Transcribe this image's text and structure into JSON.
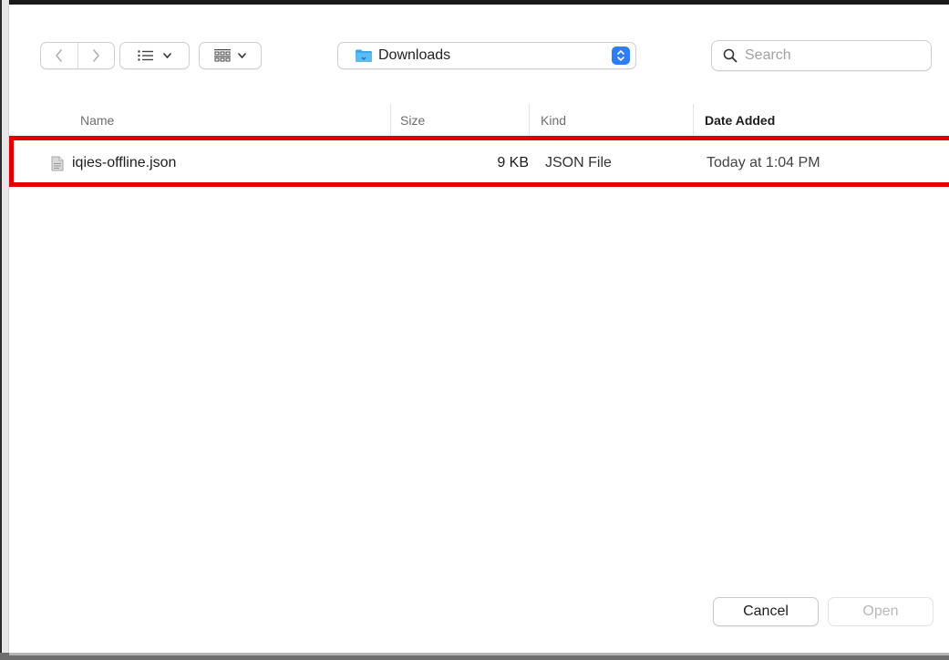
{
  "toolbar": {
    "back_icon": "chevron-left-icon",
    "forward_icon": "chevron-right-icon",
    "view_mode": "list-view-icon",
    "group_mode": "grid-view-icon",
    "location": "Downloads",
    "search_placeholder": "Search"
  },
  "columns": {
    "name": "Name",
    "size": "Size",
    "kind": "Kind",
    "date_added": "Date Added"
  },
  "files": [
    {
      "name": "iqies-offline.json",
      "size": "9 KB",
      "kind": "JSON File",
      "date_added": "Today at 1:04 PM"
    }
  ],
  "actions": {
    "cancel": "Cancel",
    "open": "Open"
  },
  "colors": {
    "accent": "#2f7df6",
    "highlight": "#e10000"
  }
}
